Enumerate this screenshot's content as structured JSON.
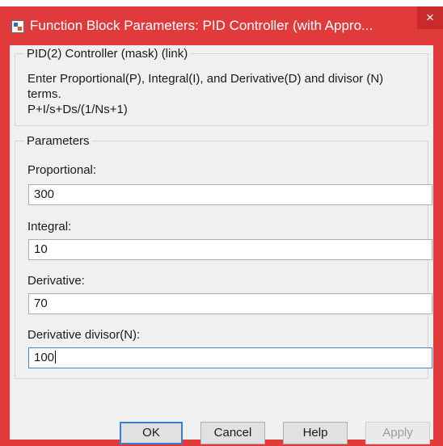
{
  "window": {
    "title": "Function Block Parameters: PID Controller (with Appro...",
    "close_glyph": "×"
  },
  "block_info": {
    "legend": "PID(2) Controller (mask) (link)",
    "description_line1": "Enter Proportional(P), Integral(I), and Derivative(D) and divisor (N)",
    "description_line2": "terms.",
    "formula": "P+I/s+Ds/(1/Ns+1)"
  },
  "parameters": {
    "legend": "Parameters",
    "fields": [
      {
        "label": "Proportional:",
        "value": "300"
      },
      {
        "label": "Integral:",
        "value": "10"
      },
      {
        "label": "Derivative:",
        "value": "70"
      },
      {
        "label": "Derivative divisor(N):",
        "value": "100"
      }
    ]
  },
  "buttons": {
    "ok": "OK",
    "cancel": "Cancel",
    "help": "Help",
    "apply": "Apply"
  },
  "colors": {
    "title_bar": "#e03a3a",
    "dialog_bg": "#f0f0f0",
    "focus_border": "#4b84c9"
  }
}
